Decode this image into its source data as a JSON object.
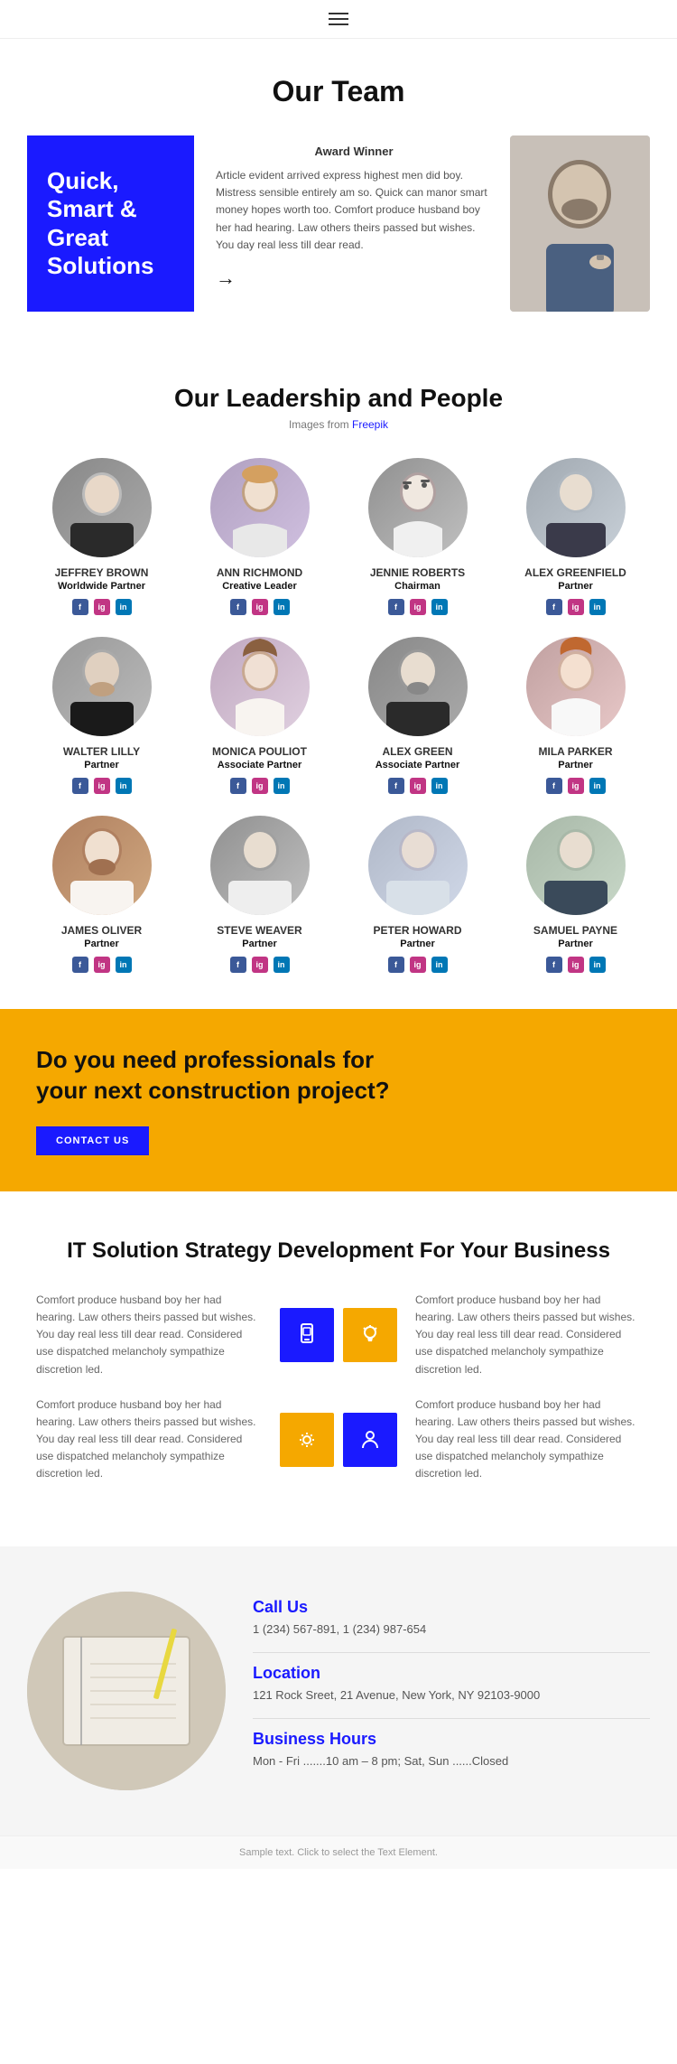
{
  "nav": {
    "menu_icon": "hamburger-icon"
  },
  "hero": {
    "title": "Our Team",
    "blue_box_text": "Quick, Smart & Great Solutions",
    "award_label": "Award Winner",
    "description": "Article evident arrived express highest men did boy. Mistress sensible entirely am so. Quick can manor smart money hopes worth too. Comfort produce husband boy her had hearing. Law others theirs passed but wishes. You day real less till dear read.",
    "arrow": "→"
  },
  "leadership": {
    "title": "Our Leadership and People",
    "subtitle": "Images from Freepik",
    "members": [
      {
        "name": "JEFFREY BROWN",
        "title": "Worldwide Partner"
      },
      {
        "name": "ANN RICHMOND",
        "title": "Creative Leader"
      },
      {
        "name": "JENNIE ROBERTS",
        "title": "Chairman"
      },
      {
        "name": "ALEX GREENFIELD",
        "title": "Partner"
      },
      {
        "name": "WALTER LILLY",
        "title": "Partner"
      },
      {
        "name": "MONICA POULIOT",
        "title": "Associate Partner"
      },
      {
        "name": "ALEX GREEN",
        "title": "Associate Partner"
      },
      {
        "name": "MILA PARKER",
        "title": "Partner"
      },
      {
        "name": "JAMES OLIVER",
        "title": "Partner"
      },
      {
        "name": "STEVE WEAVER",
        "title": "Partner"
      },
      {
        "name": "PETER HOWARD",
        "title": "Partner"
      },
      {
        "name": "SAMUEL PAYNE",
        "title": "Partner"
      }
    ]
  },
  "cta": {
    "heading": "Do you need professionals for your next construction project?",
    "button_label": "CONTACT US"
  },
  "it_section": {
    "title": "IT Solution Strategy Development For Your Business",
    "text1": "Comfort produce husband boy her had hearing. Law others theirs passed but wishes. You day real less till dear read. Considered use dispatched melancholy sympathize discretion led.",
    "text2": "Comfort produce husband boy her had hearing. Law others theirs passed but wishes. You day real less till dear read. Considered use dispatched melancholy sympathize discretion led.",
    "text3": "Comfort produce husband boy her had hearing. Law others theirs passed but wishes. You day real less till dear read. Considered use dispatched melancholy sympathize discretion led.",
    "text4": "Comfort produce husband boy her had hearing. Law others theirs passed but wishes. You day real less till dear read. Considered use dispatched melancholy sympathize discretion led."
  },
  "contact": {
    "call_title": "Call Us",
    "call_numbers": "1 (234) 567-891, 1 (234) 987-654",
    "location_title": "Location",
    "location_address": "121 Rock Sreet, 21 Avenue, New York, NY 92103-9000",
    "hours_title": "Business Hours",
    "hours_text": "Mon - Fri .......10 am – 8 pm; Sat, Sun ......Closed"
  },
  "footer": {
    "note": "Sample text. Click to select the Text Element."
  }
}
